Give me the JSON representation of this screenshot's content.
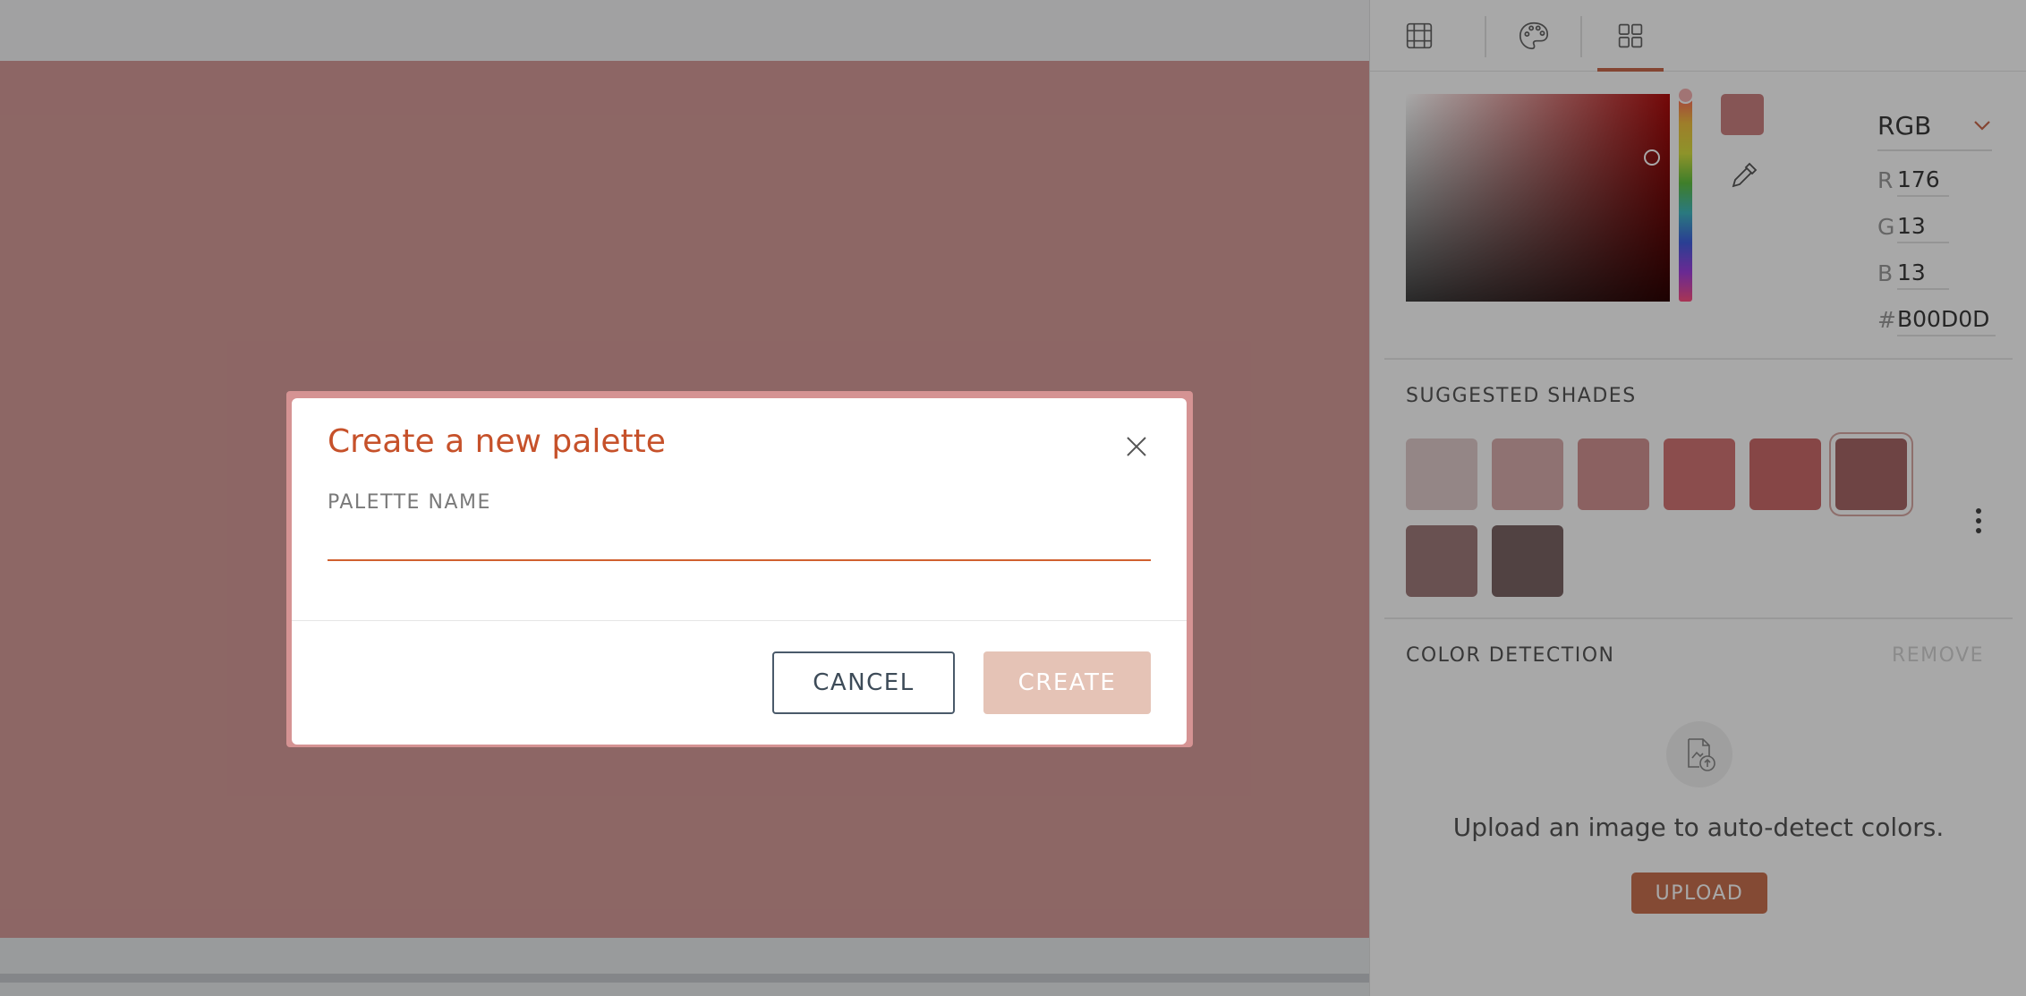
{
  "colors": {
    "accent": "#c6512a",
    "canvas": "#d69c9a",
    "current": "#cc8181",
    "hue_base": "#b00d0d"
  },
  "panel": {
    "tabs": [
      {
        "icon": "grid-frame-icon"
      },
      {
        "icon": "palette-icon"
      },
      {
        "icon": "swatches-grid-icon",
        "active": true
      }
    ],
    "mode": "RGB",
    "fields": {
      "r_label": "R",
      "r": "176",
      "g_label": "G",
      "g": "13",
      "b_label": "B",
      "b": "13",
      "hex_label": "#",
      "hex": "B00D0D"
    },
    "suggested_title": "SUGGESTED SHADES",
    "shades": [
      "#e1cbcb",
      "#d9adad",
      "#d49494",
      "#d47575",
      "#cc6b6b",
      "#a86868",
      "#a07b7b",
      "#7c6565"
    ],
    "selected_shade_index": 5,
    "detection_title": "COLOR DETECTION",
    "remove_label": "REMOVE",
    "upload_message": "Upload an image to auto-detect colors.",
    "upload_label": "UPLOAD"
  },
  "modal": {
    "title": "Create a new palette",
    "name_label": "PALETTE NAME",
    "name_value": "",
    "cancel_label": "CANCEL",
    "create_label": "CREATE"
  }
}
